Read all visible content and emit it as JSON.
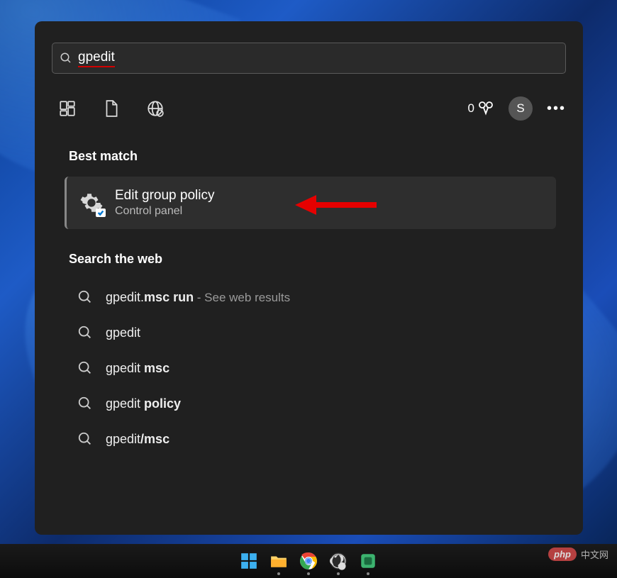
{
  "search": {
    "query": "gpedit"
  },
  "rewards": {
    "count": "0"
  },
  "avatar": {
    "initial": "S"
  },
  "sections": {
    "best_match_heading": "Best match",
    "web_heading": "Search the web"
  },
  "best_match": {
    "title": "Edit group policy",
    "subtitle": "Control panel"
  },
  "web_results": [
    {
      "prefix": "gpedit.",
      "bold": "msc run",
      "suffix": " - See web results"
    },
    {
      "prefix": "gpedit",
      "bold": "",
      "suffix": ""
    },
    {
      "prefix": "gpedit ",
      "bold": "msc",
      "suffix": ""
    },
    {
      "prefix": "gpedit ",
      "bold": "policy",
      "suffix": ""
    },
    {
      "prefix": "gpedit",
      "bold": "/msc",
      "suffix": ""
    }
  ],
  "watermark": {
    "badge": "php",
    "text": "中文网"
  }
}
